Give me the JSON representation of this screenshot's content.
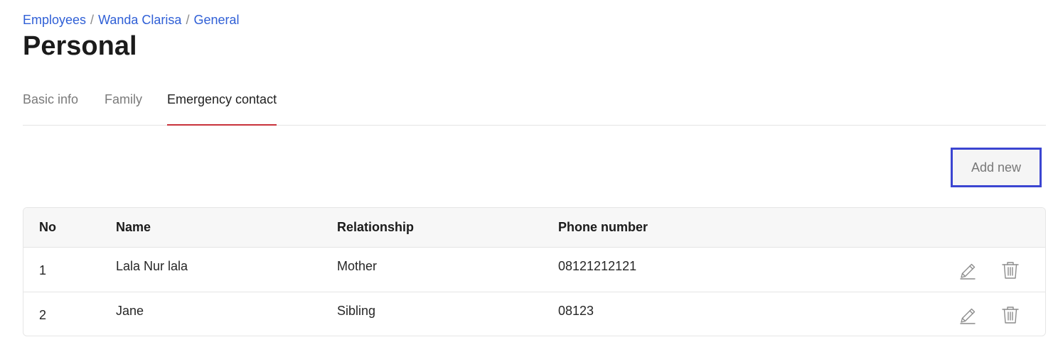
{
  "breadcrumb": {
    "items": [
      "Employees",
      "Wanda Clarisa",
      "General"
    ],
    "separator": "/"
  },
  "page_title": "Personal",
  "tabs": [
    {
      "label": "Basic info",
      "active": false
    },
    {
      "label": "Family",
      "active": false
    },
    {
      "label": "Emergency contact",
      "active": true
    }
  ],
  "actions": {
    "add_new_label": "Add new"
  },
  "table": {
    "headers": {
      "no": "No",
      "name": "Name",
      "relationship": "Relationship",
      "phone": "Phone number"
    },
    "rows": [
      {
        "no": "1",
        "name": "Lala Nur lala",
        "relationship": "Mother",
        "phone": "08121212121",
        "actions": [
          "edit-icon",
          "trash-icon"
        ]
      },
      {
        "no": "2",
        "name": "Jane",
        "relationship": "Sibling",
        "phone": "08123",
        "actions": [
          "edit-icon",
          "trash-icon"
        ]
      }
    ]
  },
  "colors": {
    "link": "#2f5fd6",
    "active_tab_underline": "#c8323a",
    "add_button_border": "#3b45d1"
  }
}
